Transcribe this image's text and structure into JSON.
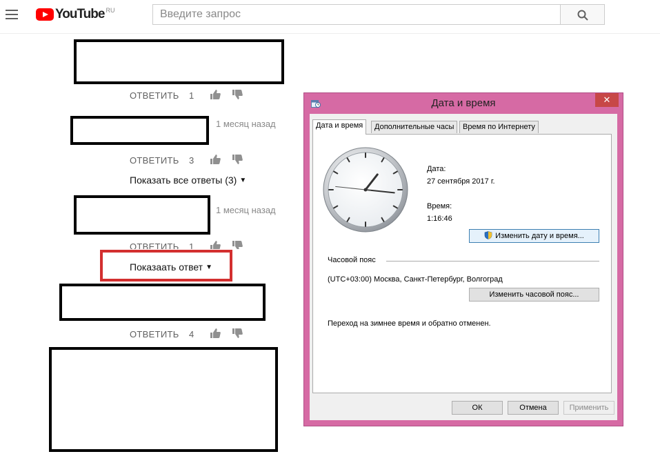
{
  "youtube": {
    "logo_text": "YouTube",
    "logo_region": "RU",
    "search_placeholder": "Введите запрос"
  },
  "comments": [
    {
      "reply_label": "ОТВЕТИТЬ",
      "likes": "1"
    },
    {
      "time_ago": "1 месяц назад",
      "reply_label": "ОТВЕТИТЬ",
      "likes": "3",
      "show_replies": "Показать все ответы (3)"
    },
    {
      "time_ago": "1 месяц назад",
      "reply_label": "ОТВЕТИТЬ",
      "likes": "1",
      "show_replies": "Показаать ответ"
    },
    {
      "reply_label": "ОТВЕТИТЬ",
      "likes": "4"
    }
  ],
  "dialog": {
    "title": "Дата и время",
    "tabs": [
      "Дата и время",
      "Дополнительные часы",
      "Время по Интернету"
    ],
    "date_label": "Дата:",
    "date_value": "27 сентября 2017 г.",
    "time_label": "Время:",
    "time_value": "1:16:46",
    "change_datetime_button": "Изменить дату и время...",
    "timezone_heading": "Часовой пояс",
    "timezone_value": "(UTC+03:00) Москва, Санкт-Петербург, Волгоград",
    "change_timezone_button": "Изменить часовой пояс...",
    "dst_note": "Переход на зимнее время и обратно отменен.",
    "ok_button": "ОК",
    "cancel_button": "Отмена",
    "apply_button": "Применить",
    "close_glyph": "✕"
  },
  "colors": {
    "youtube_red": "#ff0000",
    "window_frame": "#d66aa4",
    "highlight_red": "#d32f2f"
  }
}
